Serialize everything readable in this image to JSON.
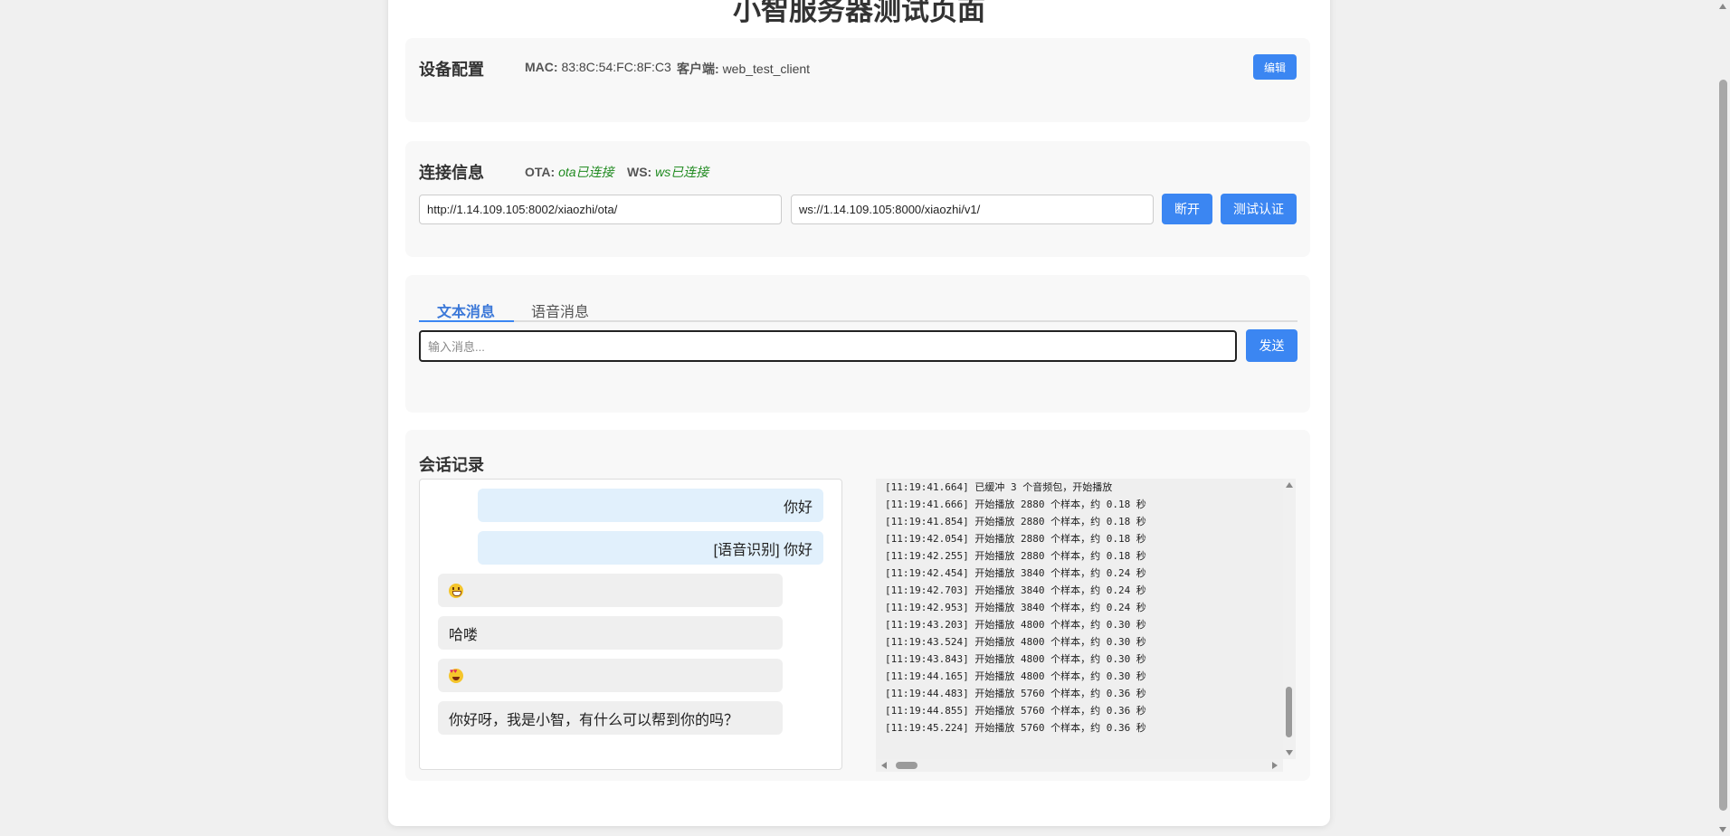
{
  "page": {
    "title": "小智服务器测试页面"
  },
  "device_config": {
    "title": "设备配置",
    "mac_label": "MAC:",
    "mac_value": "83:8C:54:FC:8F:C3",
    "client_label": "客户端:",
    "client_value": "web_test_client",
    "edit_label": "编辑"
  },
  "connection": {
    "title": "连接信息",
    "ota_label": "OTA:",
    "ota_status": "ota已连接",
    "ws_label": "WS:",
    "ws_status": "ws已连接",
    "ota_url": "http://1.14.109.105:8002/xiaozhi/ota/",
    "ws_url": "ws://1.14.109.105:8000/xiaozhi/v1/",
    "disconnect_label": "断开",
    "auth_label": "测试认证",
    "status_color": "#1f8a1f"
  },
  "message": {
    "tabs": [
      {
        "label": "文本消息",
        "active": true
      },
      {
        "label": "语音消息",
        "active": false
      }
    ],
    "input_placeholder": "输入消息...",
    "send_label": "发送"
  },
  "history": {
    "title": "会话记录",
    "messages": [
      {
        "role": "user",
        "text": "你好"
      },
      {
        "role": "user",
        "text": "[语音识别] 你好"
      },
      {
        "role": "bot",
        "icon": "grinning-face-icon"
      },
      {
        "role": "bot",
        "text": "哈喽"
      },
      {
        "role": "bot",
        "icon": "heart-eyes-face-icon"
      },
      {
        "role": "bot",
        "text": "你好呀，我是小智，有什么可以帮到你的吗？"
      }
    ],
    "log_lines": [
      "[11:19:41.664] 已缓冲 3 个音频包，开始播放",
      "[11:19:41.666] 开始播放 2880 个样本，约 0.18 秒",
      "[11:19:41.854] 开始播放 2880 个样本，约 0.18 秒",
      "[11:19:42.054] 开始播放 2880 个样本，约 0.18 秒",
      "[11:19:42.255] 开始播放 2880 个样本，约 0.18 秒",
      "[11:19:42.454] 开始播放 3840 个样本，约 0.24 秒",
      "[11:19:42.703] 开始播放 3840 个样本，约 0.24 秒",
      "[11:19:42.953] 开始播放 3840 个样本，约 0.24 秒",
      "[11:19:43.203] 开始播放 4800 个样本，约 0.30 秒",
      "[11:19:43.524] 开始播放 4800 个样本，约 0.30 秒",
      "[11:19:43.843] 开始播放 4800 个样本，约 0.30 秒",
      "[11:19:44.165] 开始播放 4800 个样本，约 0.30 秒",
      "[11:19:44.483] 开始播放 5760 个样本，约 0.36 秒",
      "[11:19:44.855] 开始播放 5760 个样本，约 0.36 秒",
      "[11:19:45.224] 开始播放 5760 个样本，约 0.36 秒"
    ]
  },
  "colors": {
    "accent": "#3b86f2",
    "user_bubble": "#e1f0fc",
    "bot_bubble": "#efefef"
  }
}
